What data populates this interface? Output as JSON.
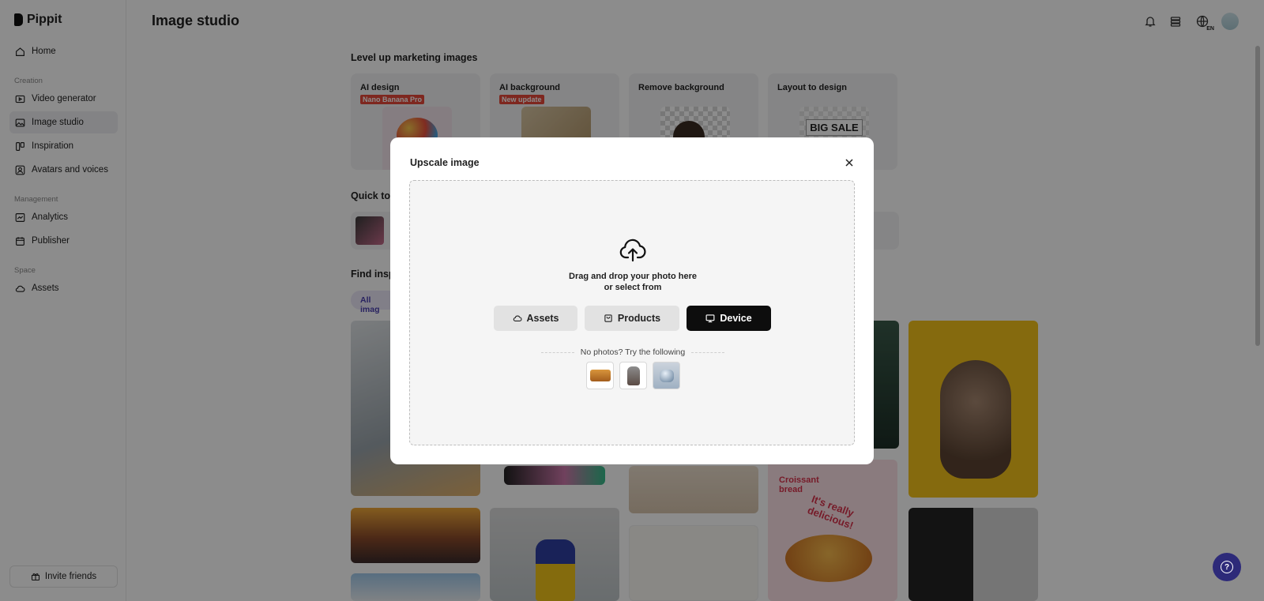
{
  "app": {
    "name": "Pippit"
  },
  "sidebar": {
    "home": "Home",
    "sections": {
      "creation": "Creation",
      "management": "Management",
      "space": "Space"
    },
    "items": [
      {
        "label": "Video generator"
      },
      {
        "label": "Image studio"
      },
      {
        "label": "Inspiration"
      },
      {
        "label": "Avatars and voices"
      },
      {
        "label": "Analytics"
      },
      {
        "label": "Publisher"
      },
      {
        "label": "Assets"
      }
    ],
    "invite": "Invite friends"
  },
  "header": {
    "title": "Image studio",
    "language": "EN"
  },
  "main": {
    "section1_title": "Level up marketing images",
    "cards": [
      {
        "title": "AI design",
        "badge": "Nano Banana Pro"
      },
      {
        "title": "AI background",
        "badge": "New update"
      },
      {
        "title": "Remove background",
        "badge": ""
      },
      {
        "title": "Layout to design",
        "badge": "",
        "thumb_text": "BIG SALE"
      }
    ],
    "quick_tools_title": "Quick to",
    "find_title": "Find insp",
    "chip": "All imag",
    "tile_texts": {
      "croissant": "Croissant bread",
      "delicious": "It's really delicious!"
    }
  },
  "modal": {
    "title": "Upscale image",
    "drop_line1": "Drag and drop your photo here",
    "drop_line2": "or select from",
    "buttons": {
      "assets": "Assets",
      "products": "Products",
      "device": "Device"
    },
    "try_text": "No photos? Try the following",
    "samples": [
      "sofa-sample",
      "backpack-sample",
      "earbuds-sample"
    ]
  },
  "colors": {
    "accent": "#4a3fb0",
    "badge_red": "#e5483a",
    "help_button": "#2d2a79"
  }
}
